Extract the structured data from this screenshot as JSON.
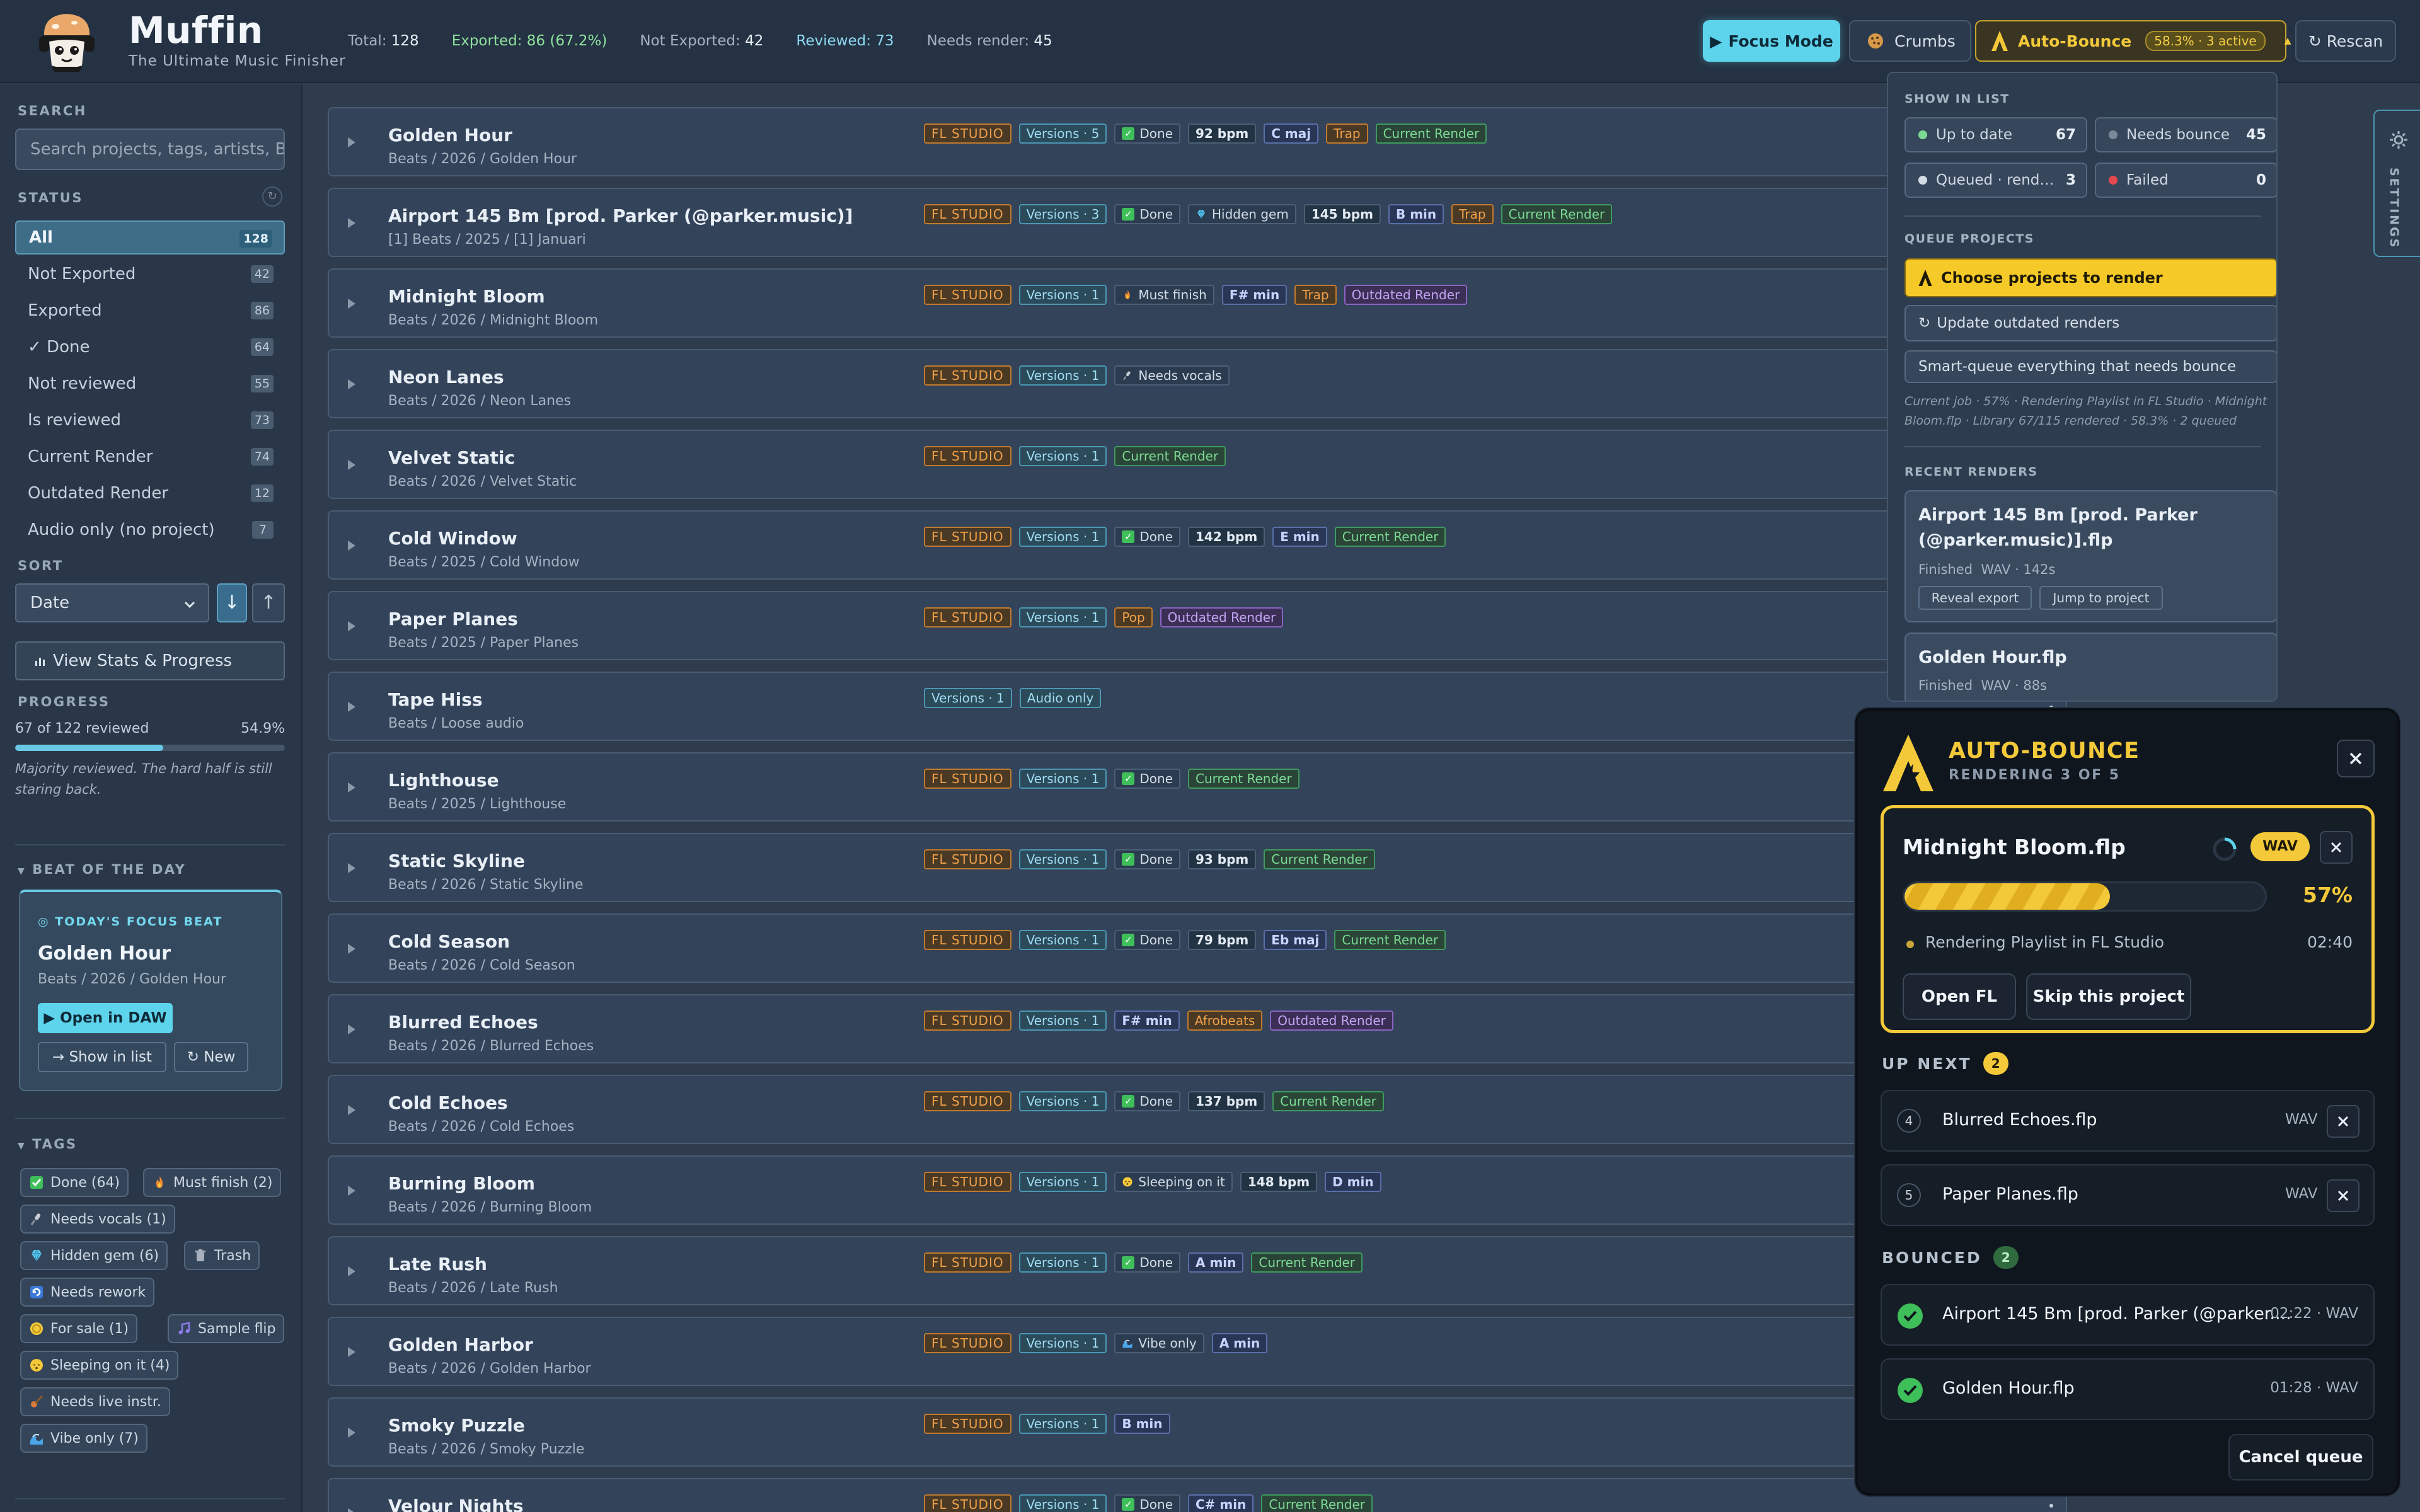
{
  "app": {
    "name": "Muffin",
    "tagline": "The Ultimate Music Finisher"
  },
  "header": {
    "stats": {
      "total_label": "Total:",
      "total": "128",
      "exported_label": "Exported:",
      "exported": "86 (67.2%)",
      "not_exported_label": "Not Exported:",
      "not_exported": "42",
      "reviewed_label": "Reviewed:",
      "reviewed": "73",
      "needs_render_label": "Needs render:",
      "needs_render": "45"
    },
    "focus_mode": "Focus Mode",
    "crumbs": "Crumbs",
    "auto_bounce": "Auto-Bounce",
    "auto_bounce_badge": "58.3% · 3 active",
    "rescan": "Rescan"
  },
  "sidebar": {
    "search_label": "SEARCH",
    "search_placeholder": "Search projects, tags, artists, BPM",
    "status_label": "STATUS",
    "status_items": [
      {
        "label": "All",
        "count": "128"
      },
      {
        "label": "Not Exported",
        "count": "42"
      },
      {
        "label": "Exported",
        "count": "86"
      },
      {
        "label": "✓ Done",
        "count": "64"
      },
      {
        "label": "Not reviewed",
        "count": "55"
      },
      {
        "label": "Is reviewed",
        "count": "73"
      },
      {
        "label": "Current Render",
        "count": "74"
      },
      {
        "label": "Outdated Render",
        "count": "12"
      },
      {
        "label": "Audio only (no project)",
        "count": "7"
      }
    ],
    "sort_label": "SORT",
    "sort_value": "Date",
    "sort_desc": "↓",
    "sort_asc": "↑",
    "view_stats": "View Stats & Progress",
    "progress_label": "PROGRESS",
    "progress_text": "67 of 122 reviewed",
    "progress_pct": "54.9%",
    "progress_value": 0.549,
    "progress_note": "Majority reviewed. The hard half is still staring back.",
    "beat_of_day_label": "BEAT OF THE DAY",
    "botd": {
      "kicker": "TODAY'S FOCUS BEAT",
      "title": "Golden Hour",
      "path": "Beats / 2026 / Golden Hour",
      "open": "Open in DAW",
      "show": "→ Show in list",
      "new": "New"
    },
    "tags_label": "TAGS",
    "tags": [
      {
        "label": "Done (64)",
        "icon": "check-icon"
      },
      {
        "label": "Must finish (2)",
        "icon": "fire-icon"
      },
      {
        "label": "Needs vocals (1)",
        "icon": "mic-icon"
      },
      {
        "label": "Hidden gem (6)",
        "icon": "gem-icon"
      },
      {
        "label": "Trash",
        "icon": "trash-icon"
      },
      {
        "label": "Needs rework",
        "icon": "rework-icon"
      },
      {
        "label": "For sale (1)",
        "icon": "coin-icon"
      },
      {
        "label": "Sample flip",
        "icon": "music-icon"
      },
      {
        "label": "Sleeping on it (4)",
        "icon": "sleep-icon"
      },
      {
        "label": "Needs live instr.",
        "icon": "guitar-icon"
      },
      {
        "label": "Vibe only (7)",
        "icon": "wave-icon"
      }
    ]
  },
  "projects": [
    {
      "title": "Golden Hour",
      "path": "Beats / 2026 / Golden Hour",
      "chips": [
        {
          "k": "fl",
          "t": "FL STUDIO"
        },
        {
          "k": "ver",
          "t": "Versions · 5"
        },
        {
          "k": "done",
          "t": "Done"
        },
        {
          "k": "bpm",
          "t": "92 bpm"
        },
        {
          "k": "key",
          "t": "C maj"
        },
        {
          "k": "genre",
          "t": "Trap"
        },
        {
          "k": "cur",
          "t": "Current Render"
        }
      ],
      "dot": "#3fbf5a"
    },
    {
      "title": "Airport 145 Bm [prod. Parker (@parker.music)]",
      "path": "[1] Beats / 2025 / [1] Januari",
      "chips": [
        {
          "k": "fl",
          "t": "FL STUDIO"
        },
        {
          "k": "ver",
          "t": "Versions · 3"
        },
        {
          "k": "done",
          "t": "Done"
        },
        {
          "k": "tag",
          "t": "Hidden gem",
          "i": "gem-icon"
        },
        {
          "k": "bpm",
          "t": "145 bpm"
        },
        {
          "k": "key",
          "t": "B min"
        },
        {
          "k": "genre",
          "t": "Trap"
        },
        {
          "k": "cur",
          "t": "Current Render"
        }
      ],
      "dot": "#3fbf5a"
    },
    {
      "title": "Midnight Bloom",
      "path": "Beats / 2026 / Midnight Bloom",
      "chips": [
        {
          "k": "fl",
          "t": "FL STUDIO"
        },
        {
          "k": "ver",
          "t": "Versions · 1"
        },
        {
          "k": "tag",
          "t": "Must finish",
          "i": "fire-icon"
        },
        {
          "k": "key",
          "t": "F# min"
        },
        {
          "k": "genre",
          "t": "Trap"
        },
        {
          "k": "out",
          "t": "Outdated Render"
        }
      ],
      "dot": "#5ed3ec"
    },
    {
      "title": "Neon Lanes",
      "path": "Beats / 2026 / Neon Lanes",
      "chips": [
        {
          "k": "fl",
          "t": "FL STUDIO"
        },
        {
          "k": "ver",
          "t": "Versions · 1"
        },
        {
          "k": "tag",
          "t": "Needs vocals",
          "i": "mic-icon"
        }
      ],
      "dot": "#6b7a8c"
    },
    {
      "title": "Velvet Static",
      "path": "Beats / 2026 / Velvet Static",
      "chips": [
        {
          "k": "fl",
          "t": "FL STUDIO"
        },
        {
          "k": "ver",
          "t": "Versions · 1"
        },
        {
          "k": "cur",
          "t": "Current Render"
        }
      ],
      "dot": "#3fbf5a"
    },
    {
      "title": "Cold Window",
      "path": "Beats / 2025 / Cold Window",
      "chips": [
        {
          "k": "fl",
          "t": "FL STUDIO"
        },
        {
          "k": "ver",
          "t": "Versions · 1"
        },
        {
          "k": "done",
          "t": "Done"
        },
        {
          "k": "bpm",
          "t": "142 bpm"
        },
        {
          "k": "key",
          "t": "E min"
        },
        {
          "k": "cur",
          "t": "Current Render"
        }
      ],
      "dot": "#3fbf5a"
    },
    {
      "title": "Paper Planes",
      "path": "Beats / 2025 / Paper Planes",
      "chips": [
        {
          "k": "fl",
          "t": "FL STUDIO"
        },
        {
          "k": "ver",
          "t": "Versions · 1"
        },
        {
          "k": "genre",
          "t": "Pop"
        },
        {
          "k": "out",
          "t": "Outdated Render"
        }
      ],
      "dot": "#e8eef5"
    },
    {
      "title": "Tape Hiss",
      "path": "Beats / Loose audio",
      "chips": [
        {
          "k": "ver",
          "t": "Versions · 1"
        },
        {
          "k": "aud",
          "t": "Audio only"
        }
      ],
      "dot": ""
    },
    {
      "title": "Lighthouse",
      "path": "Beats / 2025 / Lighthouse",
      "chips": [
        {
          "k": "fl",
          "t": "FL STUDIO"
        },
        {
          "k": "ver",
          "t": "Versions · 1"
        },
        {
          "k": "done",
          "t": "Done"
        },
        {
          "k": "cur",
          "t": "Current Render"
        }
      ],
      "dot": ""
    },
    {
      "title": "Static Skyline",
      "path": "Beats / 2026 / Static Skyline",
      "chips": [
        {
          "k": "fl",
          "t": "FL STUDIO"
        },
        {
          "k": "ver",
          "t": "Versions · 1"
        },
        {
          "k": "done",
          "t": "Done"
        },
        {
          "k": "bpm",
          "t": "93 bpm"
        },
        {
          "k": "cur",
          "t": "Current Render"
        }
      ],
      "dot": ""
    },
    {
      "title": "Cold Season",
      "path": "Beats / 2026 / Cold Season",
      "chips": [
        {
          "k": "fl",
          "t": "FL STUDIO"
        },
        {
          "k": "ver",
          "t": "Versions · 1"
        },
        {
          "k": "done",
          "t": "Done"
        },
        {
          "k": "bpm",
          "t": "79 bpm"
        },
        {
          "k": "key",
          "t": "Eb maj"
        },
        {
          "k": "cur",
          "t": "Current Render"
        }
      ],
      "dot": ""
    },
    {
      "title": "Blurred Echoes",
      "path": "Beats / 2026 / Blurred Echoes",
      "chips": [
        {
          "k": "fl",
          "t": "FL STUDIO"
        },
        {
          "k": "ver",
          "t": "Versions · 1"
        },
        {
          "k": "key",
          "t": "F# min"
        },
        {
          "k": "genre",
          "t": "Afrobeats"
        },
        {
          "k": "out",
          "t": "Outdated Render"
        }
      ],
      "dot": ""
    },
    {
      "title": "Cold Echoes",
      "path": "Beats / 2026 / Cold Echoes",
      "chips": [
        {
          "k": "fl",
          "t": "FL STUDIO"
        },
        {
          "k": "ver",
          "t": "Versions · 1"
        },
        {
          "k": "done",
          "t": "Done"
        },
        {
          "k": "bpm",
          "t": "137 bpm"
        },
        {
          "k": "cur",
          "t": "Current Render"
        }
      ],
      "dot": ""
    },
    {
      "title": "Burning Bloom",
      "path": "Beats / 2026 / Burning Bloom",
      "chips": [
        {
          "k": "fl",
          "t": "FL STUDIO"
        },
        {
          "k": "ver",
          "t": "Versions · 1"
        },
        {
          "k": "tag",
          "t": "Sleeping on it",
          "i": "sleep-icon"
        },
        {
          "k": "bpm",
          "t": "148 bpm"
        },
        {
          "k": "key",
          "t": "D min"
        }
      ],
      "dot": ""
    },
    {
      "title": "Late Rush",
      "path": "Beats / 2026 / Late Rush",
      "chips": [
        {
          "k": "fl",
          "t": "FL STUDIO"
        },
        {
          "k": "ver",
          "t": "Versions · 1"
        },
        {
          "k": "done",
          "t": "Done"
        },
        {
          "k": "key",
          "t": "A min"
        },
        {
          "k": "cur",
          "t": "Current Render"
        }
      ],
      "dot": ""
    },
    {
      "title": "Golden Harbor",
      "path": "Beats / 2026 / Golden Harbor",
      "chips": [
        {
          "k": "fl",
          "t": "FL STUDIO"
        },
        {
          "k": "ver",
          "t": "Versions · 1"
        },
        {
          "k": "tag",
          "t": "Vibe only",
          "i": "wave-icon"
        },
        {
          "k": "key",
          "t": "A min"
        }
      ],
      "dot": ""
    },
    {
      "title": "Smoky Puzzle",
      "path": "Beats / 2026 / Smoky Puzzle",
      "chips": [
        {
          "k": "fl",
          "t": "FL STUDIO"
        },
        {
          "k": "ver",
          "t": "Versions · 1"
        },
        {
          "k": "key",
          "t": "B min"
        }
      ],
      "dot": ""
    },
    {
      "title": "Velour Nights",
      "path": "",
      "chips": [
        {
          "k": "fl",
          "t": "FL STUDIO"
        },
        {
          "k": "ver",
          "t": "Versions · 1"
        },
        {
          "k": "done",
          "t": "Done"
        },
        {
          "k": "key",
          "t": "C# min"
        },
        {
          "k": "cur",
          "t": "Current Render"
        }
      ],
      "dot": ""
    }
  ],
  "menu": {
    "show_in_list": "SHOW IN LIST",
    "filters": [
      {
        "label": "Up to date",
        "count": "67",
        "color": "#7cd994"
      },
      {
        "label": "Needs bounce",
        "count": "45",
        "color": "#7a8898"
      },
      {
        "label": "Queued · rendering",
        "count": "3",
        "color": "#d3dce6"
      },
      {
        "label": "Failed",
        "count": "0",
        "color": "#e5484d"
      }
    ],
    "queue_projects": "QUEUE PROJECTS",
    "choose": "Choose projects to render",
    "update": "Update outdated renders",
    "smart": "Smart-queue everything that needs bounce",
    "current_job": "Current job · 57% · Rendering Playlist in FL Studio · Midnight Bloom.flp · Library 67/115 rendered · 58.3% · 2 queued",
    "recent_renders": "RECENT RENDERS",
    "recent": [
      {
        "title": "Airport 145 Bm [prod. Parker (@parker.music)].flp",
        "status": "Finished",
        "meta": "WAV · 142s",
        "reveal": "Reveal export",
        "jump": "Jump to project"
      },
      {
        "title": "Golden Hour.flp",
        "status": "Finished",
        "meta": "WAV · 88s"
      }
    ]
  },
  "settings_tab": "SETTINGS",
  "autobounce": {
    "title": "AUTO-BOUNCE",
    "subtitle": "RENDERING 3 OF 5",
    "current": {
      "name": "Midnight Bloom.flp",
      "format": "WAV",
      "progress": 0.57,
      "pct": "57%",
      "status": "Rendering Playlist in FL Studio",
      "time": "02:40",
      "open_fl": "Open FL",
      "skip": "Skip this project"
    },
    "up_next_label": "UP NEXT",
    "up_next_count": "2",
    "up_next": [
      {
        "n": "4",
        "name": "Blurred Echoes.flp",
        "fmt": "WAV"
      },
      {
        "n": "5",
        "name": "Paper Planes.flp",
        "fmt": "WAV"
      }
    ],
    "bounced_label": "BOUNCED",
    "bounced_count": "2",
    "bounced": [
      {
        "name": "Airport 145 Bm [prod. Parker (@parker....",
        "meta": "02:22 · WAV"
      },
      {
        "name": "Golden Hour.flp",
        "meta": "01:28 · WAV"
      }
    ],
    "cancel": "Cancel queue"
  },
  "colors": {
    "accent": "#5ed3ec",
    "autobounce": "#f3c93a",
    "done_green": "#3fbf5a",
    "outdated_purple": "#8a64c4"
  }
}
